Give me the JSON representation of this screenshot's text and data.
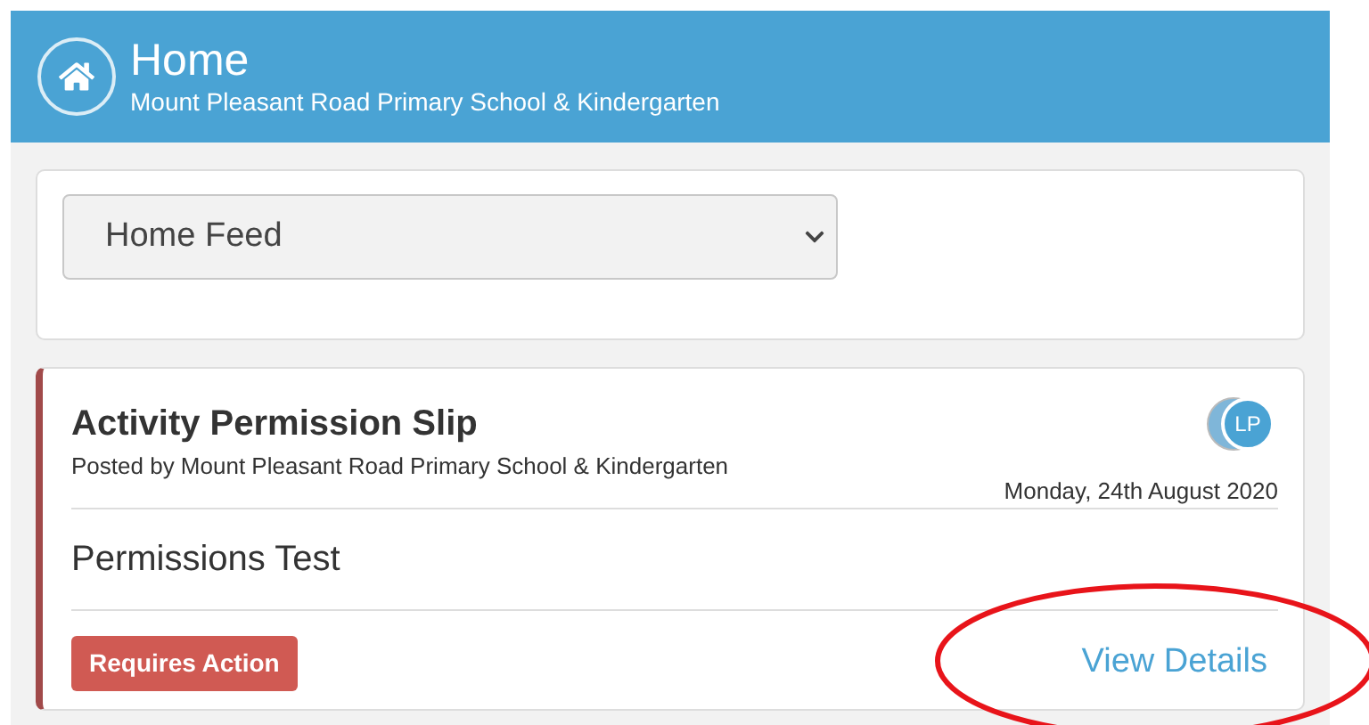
{
  "header": {
    "title": "Home",
    "subtitle": "Mount Pleasant Road Primary School & Kindergarten"
  },
  "feed_select": {
    "value": "Home Feed"
  },
  "post": {
    "title": "Activity Permission Slip",
    "posted_by": "Posted by Mount Pleasant Road Primary School & Kindergarten",
    "avatar_initials": "LP",
    "date": "Monday, 24th August 2020",
    "body": "Permissions Test",
    "status_badge": "Requires Action",
    "link": "View Details"
  }
}
